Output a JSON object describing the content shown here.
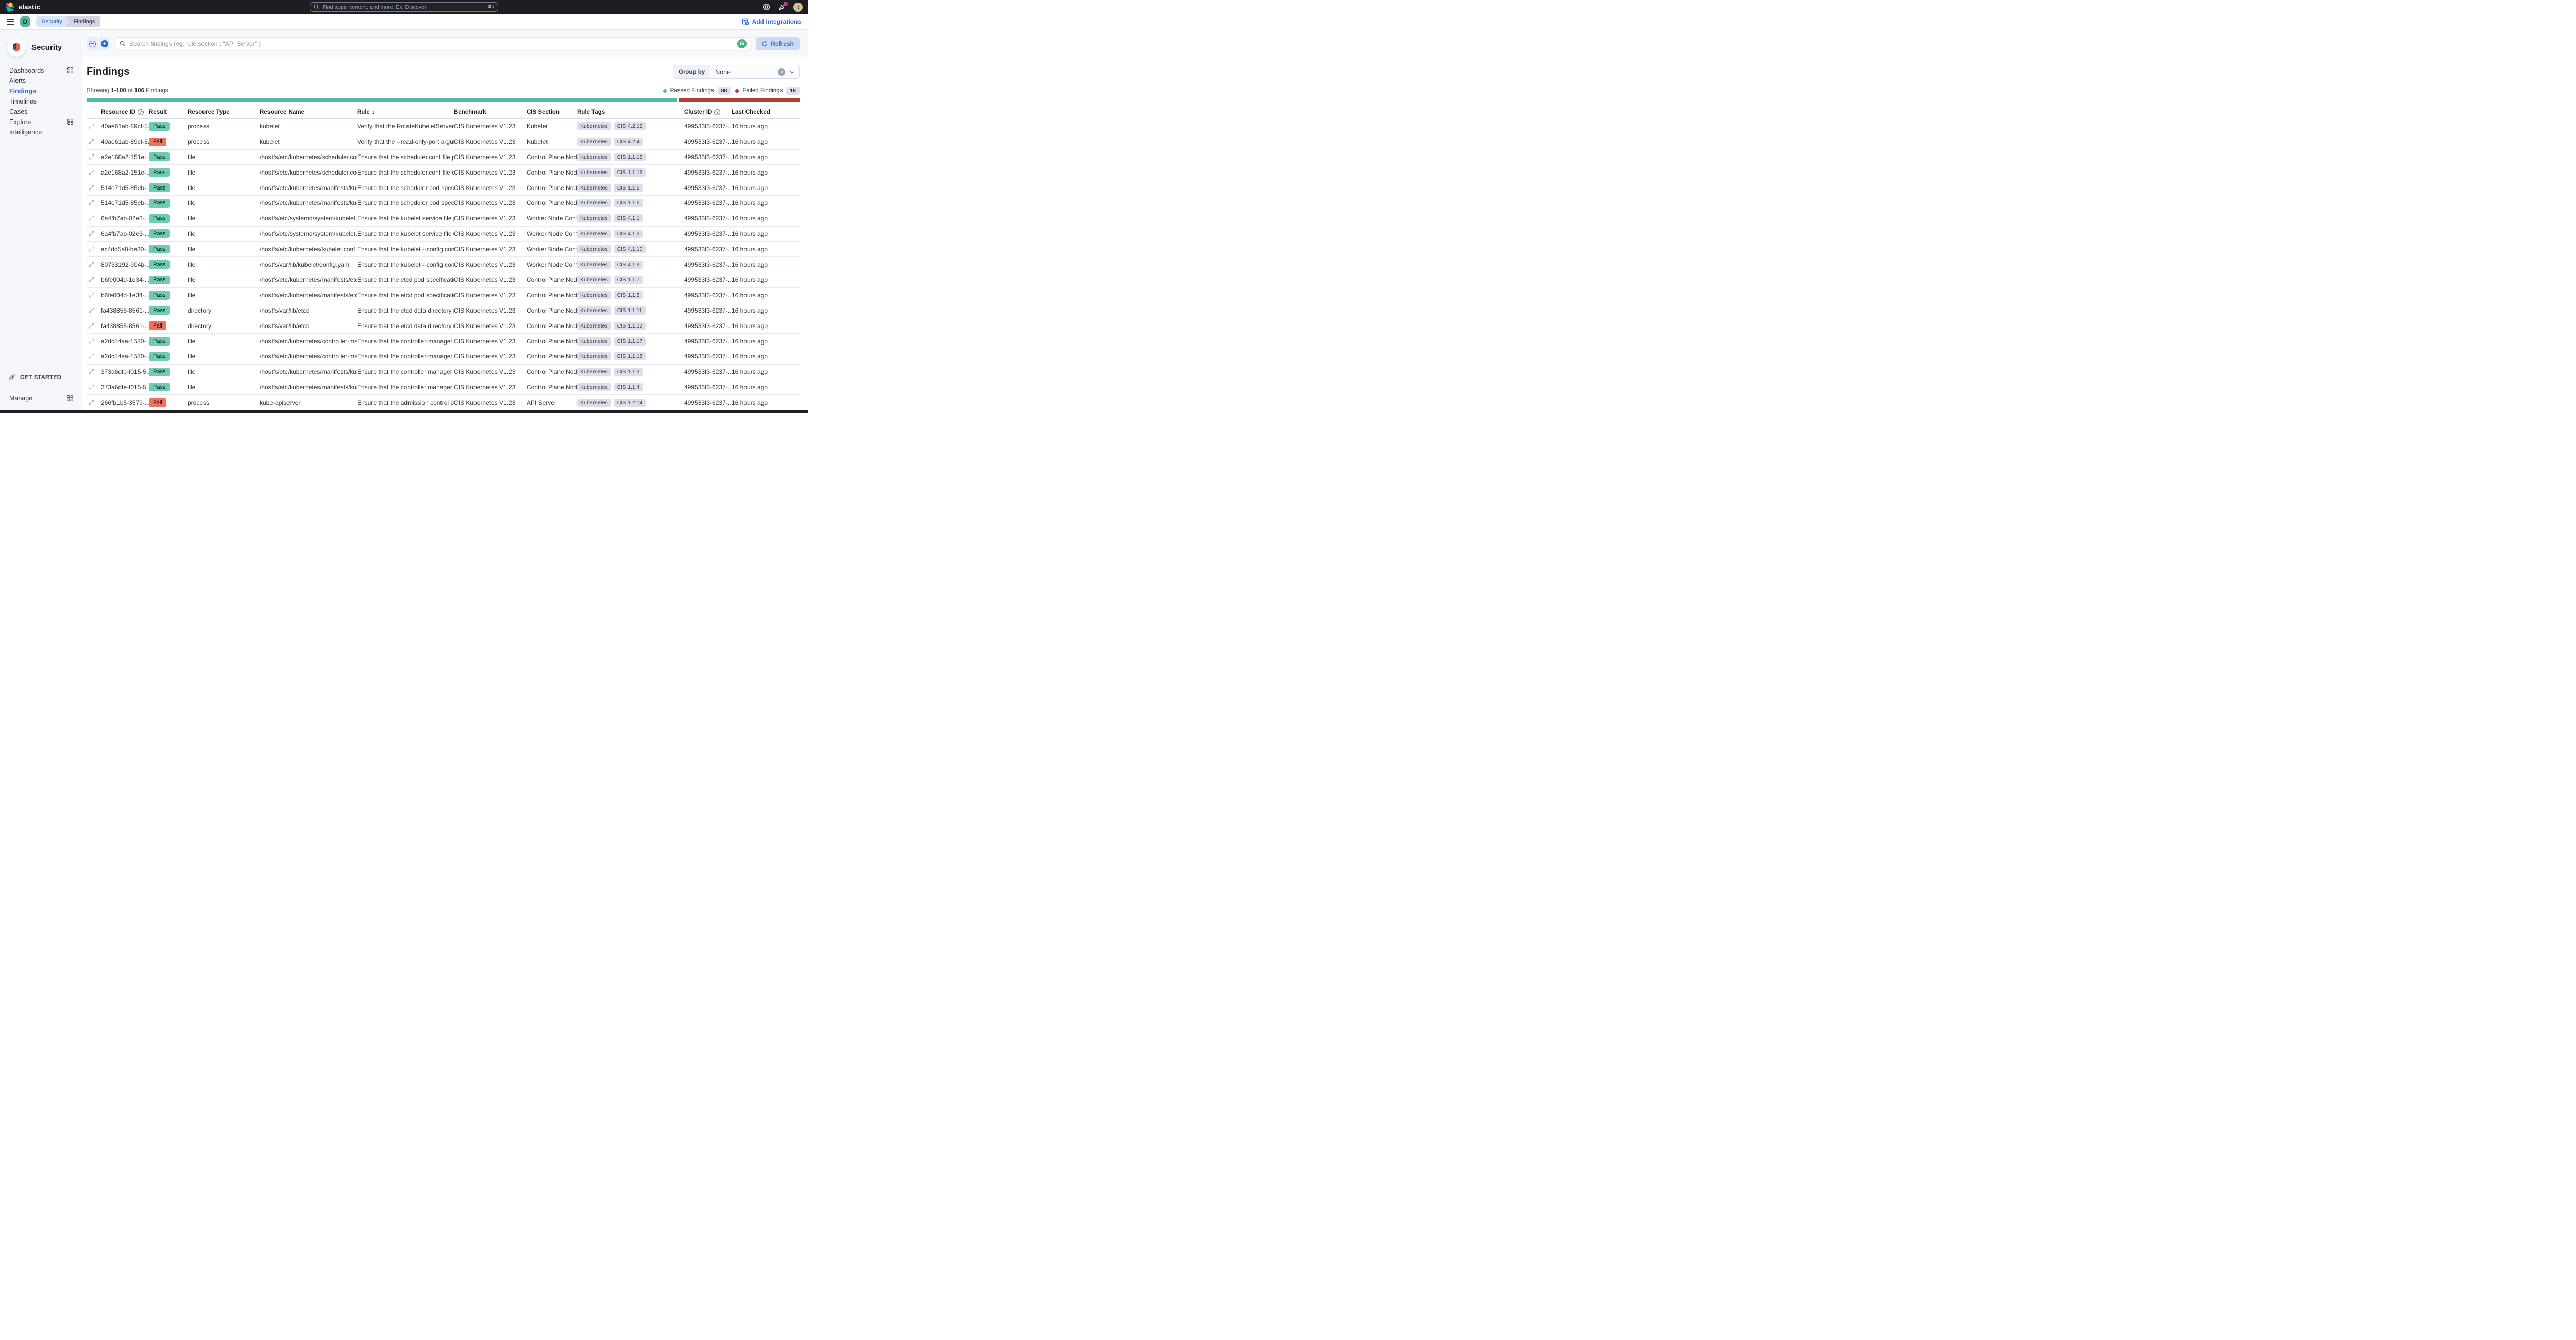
{
  "topbar": {
    "brand": "elastic",
    "search_placeholder": "Find apps, content, and more. Ex: Discover",
    "search_shortcut": "⌘/",
    "avatar_initial": "t"
  },
  "breadcrumb_bar": {
    "space_initial": "D",
    "crumb_security": "Security",
    "crumb_findings": "Findings",
    "add_integrations_label": "Add integrations"
  },
  "sidebar": {
    "title": "Security",
    "items": [
      {
        "label": "Dashboards",
        "grid_icon": true,
        "active": false
      },
      {
        "label": "Alerts",
        "grid_icon": false,
        "active": false
      },
      {
        "label": "Findings",
        "grid_icon": false,
        "active": true
      },
      {
        "label": "Timelines",
        "grid_icon": false,
        "active": false
      },
      {
        "label": "Cases",
        "grid_icon": false,
        "active": false
      },
      {
        "label": "Explore",
        "grid_icon": true,
        "active": false
      },
      {
        "label": "Intelligence",
        "grid_icon": false,
        "active": false
      }
    ],
    "get_started_label": "GET STARTED",
    "manage_label": "Manage"
  },
  "toolbar": {
    "search_placeholder": "Search findings (eg. rule.section : \"API Server\" )",
    "grammarly_letter": "G",
    "refresh_label": "Refresh"
  },
  "findings": {
    "title": "Findings",
    "group_by_label": "Group by",
    "group_by_value": "None",
    "showing_prefix": "Showing",
    "showing_range": "1-100",
    "showing_of": "of",
    "showing_total": "106",
    "showing_suffix": "Findings",
    "passed_label": "Passed Findings",
    "passed_count": "88",
    "failed_label": "Failed Findings",
    "failed_count": "18",
    "colors": {
      "passed_bar": "#54b9aa",
      "failed_bar": "#b23c32",
      "pass_badge": "#6dccb1",
      "fail_badge": "#f3705a",
      "primary_blue": "#2e6bd0"
    }
  },
  "table": {
    "headers": [
      {
        "label": "Resource ID",
        "icon": "help"
      },
      {
        "label": "Result",
        "icon": null
      },
      {
        "label": "Resource Type",
        "icon": null
      },
      {
        "label": "Resource Name",
        "icon": null
      },
      {
        "label": "Rule",
        "icon": "sort-down"
      },
      {
        "label": "Benchmark",
        "icon": null
      },
      {
        "label": "CIS Section",
        "icon": null
      },
      {
        "label": "Rule Tags",
        "icon": null
      },
      {
        "label": "Cluster ID",
        "icon": "help"
      },
      {
        "label": "Last Checked",
        "icon": null
      }
    ],
    "rows": [
      {
        "id": "40ae61ab-89cf-5...",
        "result": "Pass",
        "type": "process",
        "name": "kubelet",
        "rule": "Verify that the RotateKubeletServerCertifi...",
        "benchmark": "CIS Kubernetes V1.23",
        "section": "Kubelet",
        "tags": [
          "Kubernetes",
          "CIS 4.2.12"
        ],
        "cluster": "499533f3-6237-...",
        "checked": "16 hours ago"
      },
      {
        "id": "40ae61ab-89cf-5...",
        "result": "Fail",
        "type": "process",
        "name": "kubelet",
        "rule": "Verify that the --read-only-port argument ...",
        "benchmark": "CIS Kubernetes V1.23",
        "section": "Kubelet",
        "tags": [
          "Kubernetes",
          "CIS 4.2.4"
        ],
        "cluster": "499533f3-6237-...",
        "checked": "16 hours ago"
      },
      {
        "id": "a2e168a2-151e-...",
        "result": "Pass",
        "type": "file",
        "name": "/hostfs/etc/kubernetes/scheduler.conf",
        "rule": "Ensure that the scheduler.conf file permis...",
        "benchmark": "CIS Kubernetes V1.23",
        "section": "Control Plane Node...",
        "tags": [
          "Kubernetes",
          "CIS 1.1.15"
        ],
        "cluster": "499533f3-6237-...",
        "checked": "16 hours ago"
      },
      {
        "id": "a2e168a2-151e-...",
        "result": "Pass",
        "type": "file",
        "name": "/hostfs/etc/kubernetes/scheduler.conf",
        "rule": "Ensure that the scheduler.conf file owners...",
        "benchmark": "CIS Kubernetes V1.23",
        "section": "Control Plane Node...",
        "tags": [
          "Kubernetes",
          "CIS 1.1.16"
        ],
        "cluster": "499533f3-6237-...",
        "checked": "16 hours ago"
      },
      {
        "id": "514e71d5-85eb-...",
        "result": "Pass",
        "type": "file",
        "name": "/hostfs/etc/kubernetes/manifests/kube-sc...",
        "rule": "Ensure that the scheduler pod specificatio...",
        "benchmark": "CIS Kubernetes V1.23",
        "section": "Control Plane Node...",
        "tags": [
          "Kubernetes",
          "CIS 1.1.5"
        ],
        "cluster": "499533f3-6237-...",
        "checked": "16 hours ago"
      },
      {
        "id": "514e71d5-85eb-...",
        "result": "Pass",
        "type": "file",
        "name": "/hostfs/etc/kubernetes/manifests/kube-sc...",
        "rule": "Ensure that the scheduler pod specificatio...",
        "benchmark": "CIS Kubernetes V1.23",
        "section": "Control Plane Node...",
        "tags": [
          "Kubernetes",
          "CIS 1.1.6"
        ],
        "cluster": "499533f3-6237-...",
        "checked": "16 hours ago"
      },
      {
        "id": "6a4fb7ab-02e3-...",
        "result": "Pass",
        "type": "file",
        "name": "/hostfs/etc/systemd/system/kubelet.servi...",
        "rule": "Ensure that the kubelet service file permis...",
        "benchmark": "CIS Kubernetes V1.23",
        "section": "Worker Node Confi...",
        "tags": [
          "Kubernetes",
          "CIS 4.1.1"
        ],
        "cluster": "499533f3-6237-...",
        "checked": "16 hours ago"
      },
      {
        "id": "6a4fb7ab-02e3-...",
        "result": "Pass",
        "type": "file",
        "name": "/hostfs/etc/systemd/system/kubelet.servi...",
        "rule": "Ensure that the kubelet service file owner...",
        "benchmark": "CIS Kubernetes V1.23",
        "section": "Worker Node Confi...",
        "tags": [
          "Kubernetes",
          "CIS 4.1.2"
        ],
        "cluster": "499533f3-6237-...",
        "checked": "16 hours ago"
      },
      {
        "id": "ac4dd5a8-be30-...",
        "result": "Pass",
        "type": "file",
        "name": "/hostfs/etc/kubernetes/kubelet.conf",
        "rule": "Ensure that the kubelet --config configura...",
        "benchmark": "CIS Kubernetes V1.23",
        "section": "Worker Node Confi...",
        "tags": [
          "Kubernetes",
          "CIS 4.1.10"
        ],
        "cluster": "499533f3-6237-...",
        "checked": "16 hours ago"
      },
      {
        "id": "80733192-904b-...",
        "result": "Pass",
        "type": "file",
        "name": "/hostfs/var/lib/kubelet/config.yaml",
        "rule": "Ensure that the kubelet --config configura...",
        "benchmark": "CIS Kubernetes V1.23",
        "section": "Worker Node Confi...",
        "tags": [
          "Kubernetes",
          "CIS 4.1.9"
        ],
        "cluster": "499533f3-6237-...",
        "checked": "16 hours ago"
      },
      {
        "id": "b6fe004d-1e34-...",
        "result": "Pass",
        "type": "file",
        "name": "/hostfs/etc/kubernetes/manifests/etcd.yaml",
        "rule": "Ensure that the etcd pod specification file ...",
        "benchmark": "CIS Kubernetes V1.23",
        "section": "Control Plane Node...",
        "tags": [
          "Kubernetes",
          "CIS 1.1.7"
        ],
        "cluster": "499533f3-6237-...",
        "checked": "16 hours ago"
      },
      {
        "id": "b6fe004d-1e34-...",
        "result": "Pass",
        "type": "file",
        "name": "/hostfs/etc/kubernetes/manifests/etcd.yaml",
        "rule": "Ensure that the etcd pod specification file ...",
        "benchmark": "CIS Kubernetes V1.23",
        "section": "Control Plane Node...",
        "tags": [
          "Kubernetes",
          "CIS 1.1.8"
        ],
        "cluster": "499533f3-6237-...",
        "checked": "16 hours ago"
      },
      {
        "id": "fa438855-8561-...",
        "result": "Pass",
        "type": "directory",
        "name": "/hostfs/var/lib/etcd",
        "rule": "Ensure that the etcd data directory permis...",
        "benchmark": "CIS Kubernetes V1.23",
        "section": "Control Plane Node...",
        "tags": [
          "Kubernetes",
          "CIS 1.1.11"
        ],
        "cluster": "499533f3-6237-...",
        "checked": "16 hours ago"
      },
      {
        "id": "fa438855-8561-...",
        "result": "Fail",
        "type": "directory",
        "name": "/hostfs/var/lib/etcd",
        "rule": "Ensure that the etcd data directory owner...",
        "benchmark": "CIS Kubernetes V1.23",
        "section": "Control Plane Node...",
        "tags": [
          "Kubernetes",
          "CIS 1.1.12"
        ],
        "cluster": "499533f3-6237-...",
        "checked": "16 hours ago"
      },
      {
        "id": "a2dc54aa-1580-...",
        "result": "Pass",
        "type": "file",
        "name": "/hostfs/etc/kubernetes/controller-manage...",
        "rule": "Ensure that the controller-manager.conf fil...",
        "benchmark": "CIS Kubernetes V1.23",
        "section": "Control Plane Node...",
        "tags": [
          "Kubernetes",
          "CIS 1.1.17"
        ],
        "cluster": "499533f3-6237-...",
        "checked": "16 hours ago"
      },
      {
        "id": "a2dc54aa-1580-...",
        "result": "Pass",
        "type": "file",
        "name": "/hostfs/etc/kubernetes/controller-manage...",
        "rule": "Ensure that the controller-manager.conf fil...",
        "benchmark": "CIS Kubernetes V1.23",
        "section": "Control Plane Node...",
        "tags": [
          "Kubernetes",
          "CIS 1.1.18"
        ],
        "cluster": "499533f3-6237-...",
        "checked": "16 hours ago"
      },
      {
        "id": "373a6dfe-f015-5...",
        "result": "Pass",
        "type": "file",
        "name": "/hostfs/etc/kubernetes/manifests/kube-co...",
        "rule": "Ensure that the controller manager pod sp...",
        "benchmark": "CIS Kubernetes V1.23",
        "section": "Control Plane Node...",
        "tags": [
          "Kubernetes",
          "CIS 1.1.3"
        ],
        "cluster": "499533f3-6237-...",
        "checked": "16 hours ago"
      },
      {
        "id": "373a6dfe-f015-5...",
        "result": "Pass",
        "type": "file",
        "name": "/hostfs/etc/kubernetes/manifests/kube-co...",
        "rule": "Ensure that the controller manager pod sp...",
        "benchmark": "CIS Kubernetes V1.23",
        "section": "Control Plane Node...",
        "tags": [
          "Kubernetes",
          "CIS 1.1.4"
        ],
        "cluster": "499533f3-6237-...",
        "checked": "16 hours ago"
      },
      {
        "id": "266fb1b5-3579-...",
        "result": "Fail",
        "type": "process",
        "name": "kube-apiserver",
        "rule": "Ensure that the admission control plugin S...",
        "benchmark": "CIS Kubernetes V1.23",
        "section": "API Server",
        "tags": [
          "Kubernetes",
          "CIS 1.2.14"
        ],
        "cluster": "499533f3-6237-...",
        "checked": "16 hours ago"
      }
    ]
  }
}
